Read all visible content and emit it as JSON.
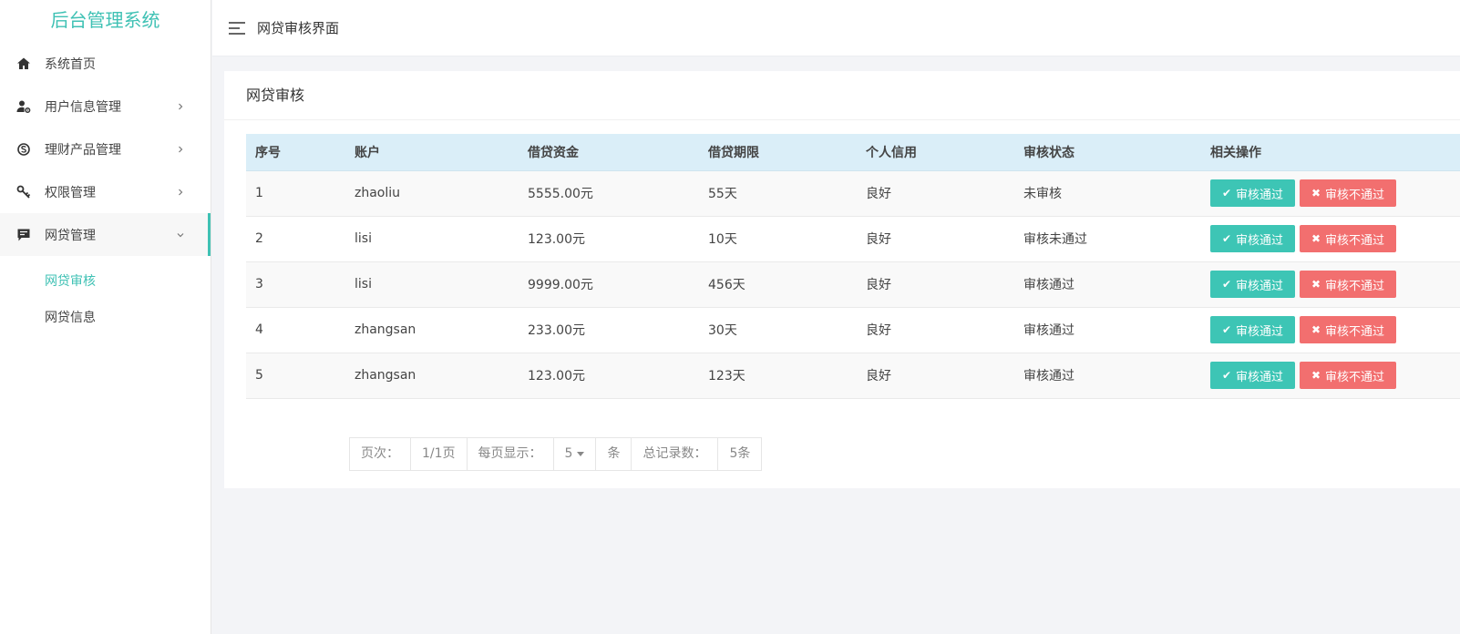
{
  "sidebar": {
    "brand": "后台管理系统",
    "menu": [
      {
        "label": "系统首页",
        "icon": "home-icon"
      },
      {
        "label": "用户信息管理",
        "icon": "user-gear-icon"
      },
      {
        "label": "理财产品管理",
        "icon": "skype-icon"
      },
      {
        "label": "权限管理",
        "icon": "key-icon"
      },
      {
        "label": "网贷管理",
        "icon": "comment-icon"
      }
    ],
    "submenu": [
      {
        "label": "网贷审核"
      },
      {
        "label": "网贷信息"
      }
    ]
  },
  "header": {
    "title": "网贷审核界面"
  },
  "card": {
    "title": "网贷审核"
  },
  "table": {
    "columns": [
      "序号",
      "账户",
      "借贷资金",
      "借贷期限",
      "个人信用",
      "审核状态",
      "相关操作"
    ],
    "rows": [
      [
        "1",
        "zhaoliu",
        "5555.00元",
        "55天",
        "良好",
        "未审核"
      ],
      [
        "2",
        "lisi",
        "123.00元",
        "10天",
        "良好",
        "审核未通过"
      ],
      [
        "3",
        "lisi",
        "9999.00元",
        "456天",
        "良好",
        "审核通过"
      ],
      [
        "4",
        "zhangsan",
        "233.00元",
        "30天",
        "良好",
        "审核通过"
      ],
      [
        "5",
        "zhangsan",
        "123.00元",
        "123天",
        "良好",
        "审核通过"
      ]
    ],
    "pass_label": "审核通过",
    "reject_label": "审核不通过"
  },
  "pager": {
    "page_label": "页次：",
    "page_value": "1/1页",
    "per_page_label": "每页显示：",
    "per_page_value": "5",
    "unit": "条",
    "total_label": "总记录数：",
    "total_value": "5条"
  },
  "colors": {
    "accent": "#3fc1b4",
    "pass": "#3dc5b5",
    "reject": "#f26f6f",
    "header_row": "#daeef8"
  }
}
